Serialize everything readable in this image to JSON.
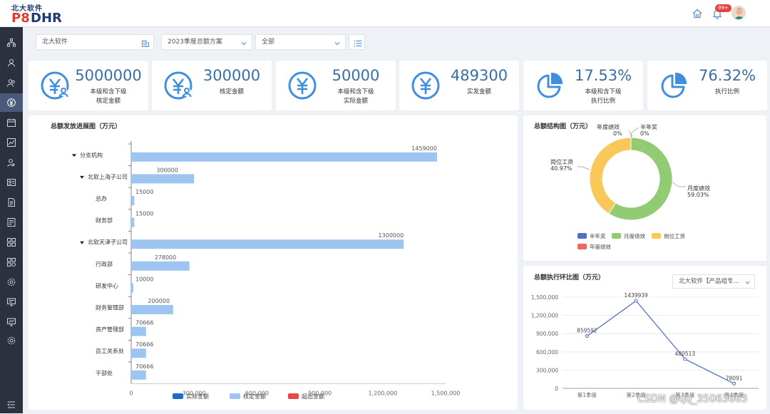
{
  "header": {
    "logo_cn": "北大软件",
    "logo_p8": "P8",
    "logo_dhr": "DHR",
    "badge": "99+"
  },
  "filters": {
    "company": "北大软件",
    "plan": "2023季度总额方案",
    "scope": "全部"
  },
  "cards": [
    {
      "value": "5000000",
      "label1": "本级和含下级",
      "label2": "核定金额",
      "icon": "yen-person-icon"
    },
    {
      "value": "300000",
      "label1": "核定金额",
      "label2": "",
      "icon": "yen-person-icon"
    },
    {
      "value": "50000",
      "label1": "本级和含下级",
      "label2": "实际金额",
      "icon": "yen-icon"
    },
    {
      "value": "489300",
      "label1": "实发金额",
      "label2": "",
      "icon": "yen-icon"
    },
    {
      "value": "17.53%",
      "label1": "本级和含下级",
      "label2": "执行比例",
      "icon": "pie-icon"
    },
    {
      "value": "76.32%",
      "label1": "执行比例",
      "label2": "",
      "icon": "pie-icon"
    }
  ],
  "colors": {
    "accent": "#3a6ea5",
    "bar_actual": "#1f6bc8",
    "bar_approved": "#9ec4f2",
    "bar_over": "#e8484a",
    "donut_half": "#4f6fc6",
    "donut_month": "#91cc75",
    "donut_post": "#fac858",
    "donut_year": "#ee6666",
    "line": "#5470c6"
  },
  "bar_chart": {
    "title": "总额发放进展图（万元）",
    "legend": [
      "实际金额",
      "核定金额",
      "超出金额"
    ],
    "chart_data": {
      "type": "bar",
      "orientation": "horizontal",
      "categories": [
        "分支机构",
        "北软上海子公司",
        "总办",
        "财务部",
        "北软天津子公司",
        "行政部",
        "研发中心",
        "财务管理部",
        "资产管理部",
        "员工关系处",
        "干部处"
      ],
      "tree_expanded": [
        true,
        true,
        false,
        false,
        true,
        false,
        false,
        false,
        false,
        false,
        false
      ],
      "indent": [
        0,
        1,
        2,
        2,
        1,
        2,
        2,
        2,
        2,
        2,
        2
      ],
      "series": [
        {
          "name": "核定金额",
          "values": [
            1459000,
            300000,
            15000,
            15000,
            1300000,
            278000,
            10000,
            200000,
            70666,
            70666,
            70666
          ]
        }
      ],
      "x_ticks": [
        "0",
        "300,000",
        "600,000",
        "900,000",
        "1,200,000",
        "1,500,000"
      ],
      "xlim": [
        0,
        1500000
      ]
    }
  },
  "donut_chart": {
    "title": "总额结构图（万元）",
    "chart_data": {
      "type": "pie",
      "slices": [
        {
          "name": "半年奖",
          "pct": "0%",
          "value": 0
        },
        {
          "name": "月度绩效",
          "pct": "59.03%",
          "value": 59.03
        },
        {
          "name": "岗位工资",
          "pct": "40.97%",
          "value": 40.97
        },
        {
          "name": "年度绩效",
          "pct": "0%",
          "value": 0
        }
      ]
    }
  },
  "line_chart": {
    "title": "总额执行环比图（万元）",
    "selector": "北大软件【产品组专...",
    "chart_data": {
      "type": "line",
      "categories": [
        "第1季度",
        "第2季度",
        "第3季度",
        "第4季度"
      ],
      "values": [
        859592,
        1439939,
        480513,
        78091
      ],
      "y_ticks": [
        "0",
        "300,000",
        "600,000",
        "900,000",
        "1,200,000",
        "1,500,000"
      ],
      "ylim": [
        0,
        1500000
      ]
    }
  },
  "watermark": "CSDN @qq_35063663"
}
